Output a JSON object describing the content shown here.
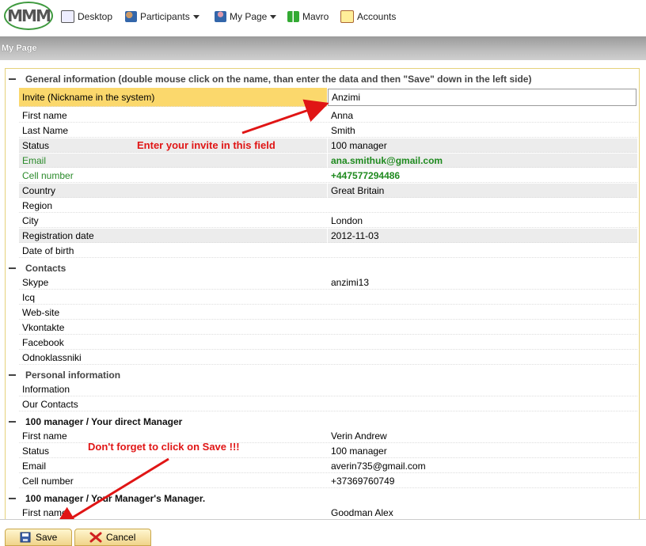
{
  "nav": {
    "logo_text": "MMM",
    "items": [
      {
        "label": "Desktop",
        "icon": "desktop-icon",
        "dropdown": false
      },
      {
        "label": "Participants",
        "icon": "participants-icon",
        "dropdown": true
      },
      {
        "label": "My Page",
        "icon": "user-icon",
        "dropdown": true
      },
      {
        "label": "Mavro",
        "icon": "butterfly-icon",
        "dropdown": false
      },
      {
        "label": "Accounts",
        "icon": "accounts-icon",
        "dropdown": false
      }
    ]
  },
  "page_title": "My Page",
  "sections": {
    "general": "General information (double mouse click on the name, than enter the data and then \"Save\" down in the left side)",
    "contacts": "Contacts",
    "personal": "Personal information",
    "manager": "100 manager / Your direct Manager",
    "managers_manager": "100 manager / Your Manager's Manager."
  },
  "general_rows": [
    {
      "label": "Invite (Nickname in the system)",
      "value": "Anzimi"
    },
    {
      "label": "First name",
      "value": "Anna"
    },
    {
      "label": "Last Name",
      "value": "Smith"
    },
    {
      "label": "Status",
      "value": "100 manager"
    },
    {
      "label": "Email",
      "value": "ana.smithuk@gmail.com"
    },
    {
      "label": "Cell number",
      "value": "+447577294486"
    },
    {
      "label": "Country",
      "value": "Great Britain"
    },
    {
      "label": "Region",
      "value": ""
    },
    {
      "label": "City",
      "value": "London"
    },
    {
      "label": "Registration date",
      "value": "2012-11-03"
    },
    {
      "label": "Date of birth",
      "value": ""
    }
  ],
  "contact_rows": [
    {
      "label": "Skype",
      "value": "anzimi13"
    },
    {
      "label": "Icq",
      "value": ""
    },
    {
      "label": "Web-site",
      "value": ""
    },
    {
      "label": "Vkontakte",
      "value": ""
    },
    {
      "label": "Facebook",
      "value": ""
    },
    {
      "label": "Odnoklassniki",
      "value": ""
    }
  ],
  "personal_rows": [
    {
      "label": "Information",
      "value": ""
    },
    {
      "label": "Our Contacts",
      "value": ""
    }
  ],
  "manager_rows": [
    {
      "label": "First name",
      "value": "Verin Andrew"
    },
    {
      "label": "Status",
      "value": "100 manager"
    },
    {
      "label": "Email",
      "value": "averin735@gmail.com"
    },
    {
      "label": "Cell number",
      "value": "+37369760749"
    }
  ],
  "managers_manager_rows": [
    {
      "label": "First name",
      "value": "Goodman Alex"
    }
  ],
  "annotations": {
    "invite_hint": "Enter your invite in this field",
    "save_hint": "Don't forget to click on Save !!!"
  },
  "buttons": {
    "save": "Save",
    "cancel": "Cancel"
  },
  "colors": {
    "header_gold": "#fbd86c",
    "annotation_red": "#e01515",
    "email_green": "#1f8a1f"
  }
}
